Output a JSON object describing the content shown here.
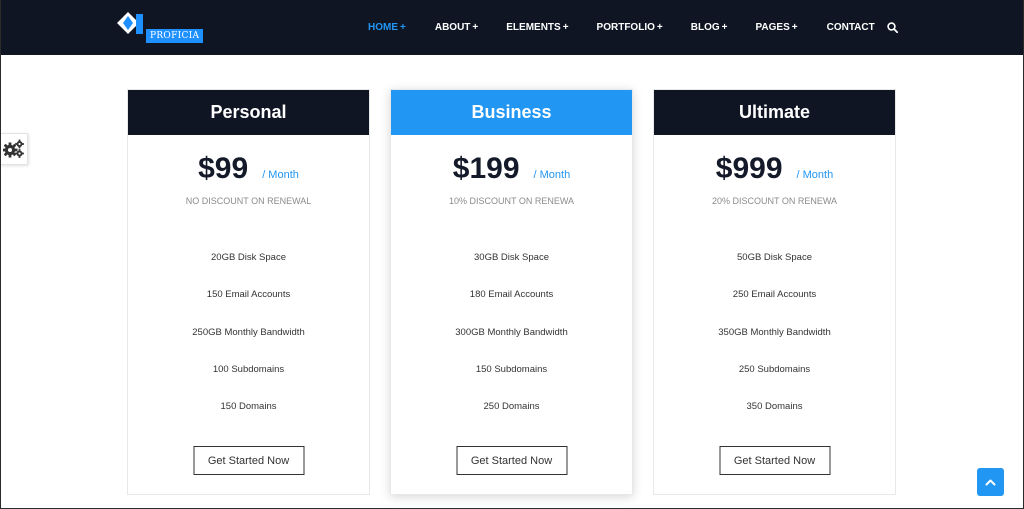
{
  "brand": {
    "name": "PROFICIA",
    "color": "#1e90ff"
  },
  "colors": {
    "navy": "#0f1523",
    "accent": "#2196f3"
  },
  "nav": [
    {
      "label": "HOME",
      "has_plus": true,
      "active": true
    },
    {
      "label": "ABOUT",
      "has_plus": true
    },
    {
      "label": "ELEMENTS",
      "has_plus": true
    },
    {
      "label": "PORTFOLIO",
      "has_plus": true
    },
    {
      "label": "BLOG",
      "has_plus": true
    },
    {
      "label": "PAGES",
      "has_plus": true
    },
    {
      "label": "CONTACT",
      "has_plus": false
    }
  ],
  "nav_plus": "+",
  "icons": {
    "search": "search-icon",
    "settings": "gear-icon",
    "scroll_top": "chevron-up-icon"
  },
  "plans": [
    {
      "name": "Personal",
      "price": "$99",
      "period": "/ Month",
      "discount": "NO DISCOUNT ON RENEWAL",
      "features": [
        "20GB Disk Space",
        "150 Email Accounts",
        "250GB Monthly Bandwidth",
        "100 Subdomains",
        "150 Domains"
      ],
      "cta": "Get Started Now",
      "featured": false
    },
    {
      "name": "Business",
      "price": "$199",
      "period": "/ Month",
      "discount": "10% DISCOUNT ON RENEWA",
      "features": [
        "30GB Disk Space",
        "180 Email Accounts",
        "300GB Monthly Bandwidth",
        "150 Subdomains",
        "250 Domains"
      ],
      "cta": "Get Started Now",
      "featured": true
    },
    {
      "name": "Ultimate",
      "price": "$999",
      "period": "/ Month",
      "discount": "20% DISCOUNT ON RENEWA",
      "features": [
        "50GB Disk Space",
        "250 Email Accounts",
        "350GB Monthly Bandwidth",
        "250 Subdomains",
        "350 Domains"
      ],
      "cta": "Get Started Now",
      "featured": false
    }
  ]
}
